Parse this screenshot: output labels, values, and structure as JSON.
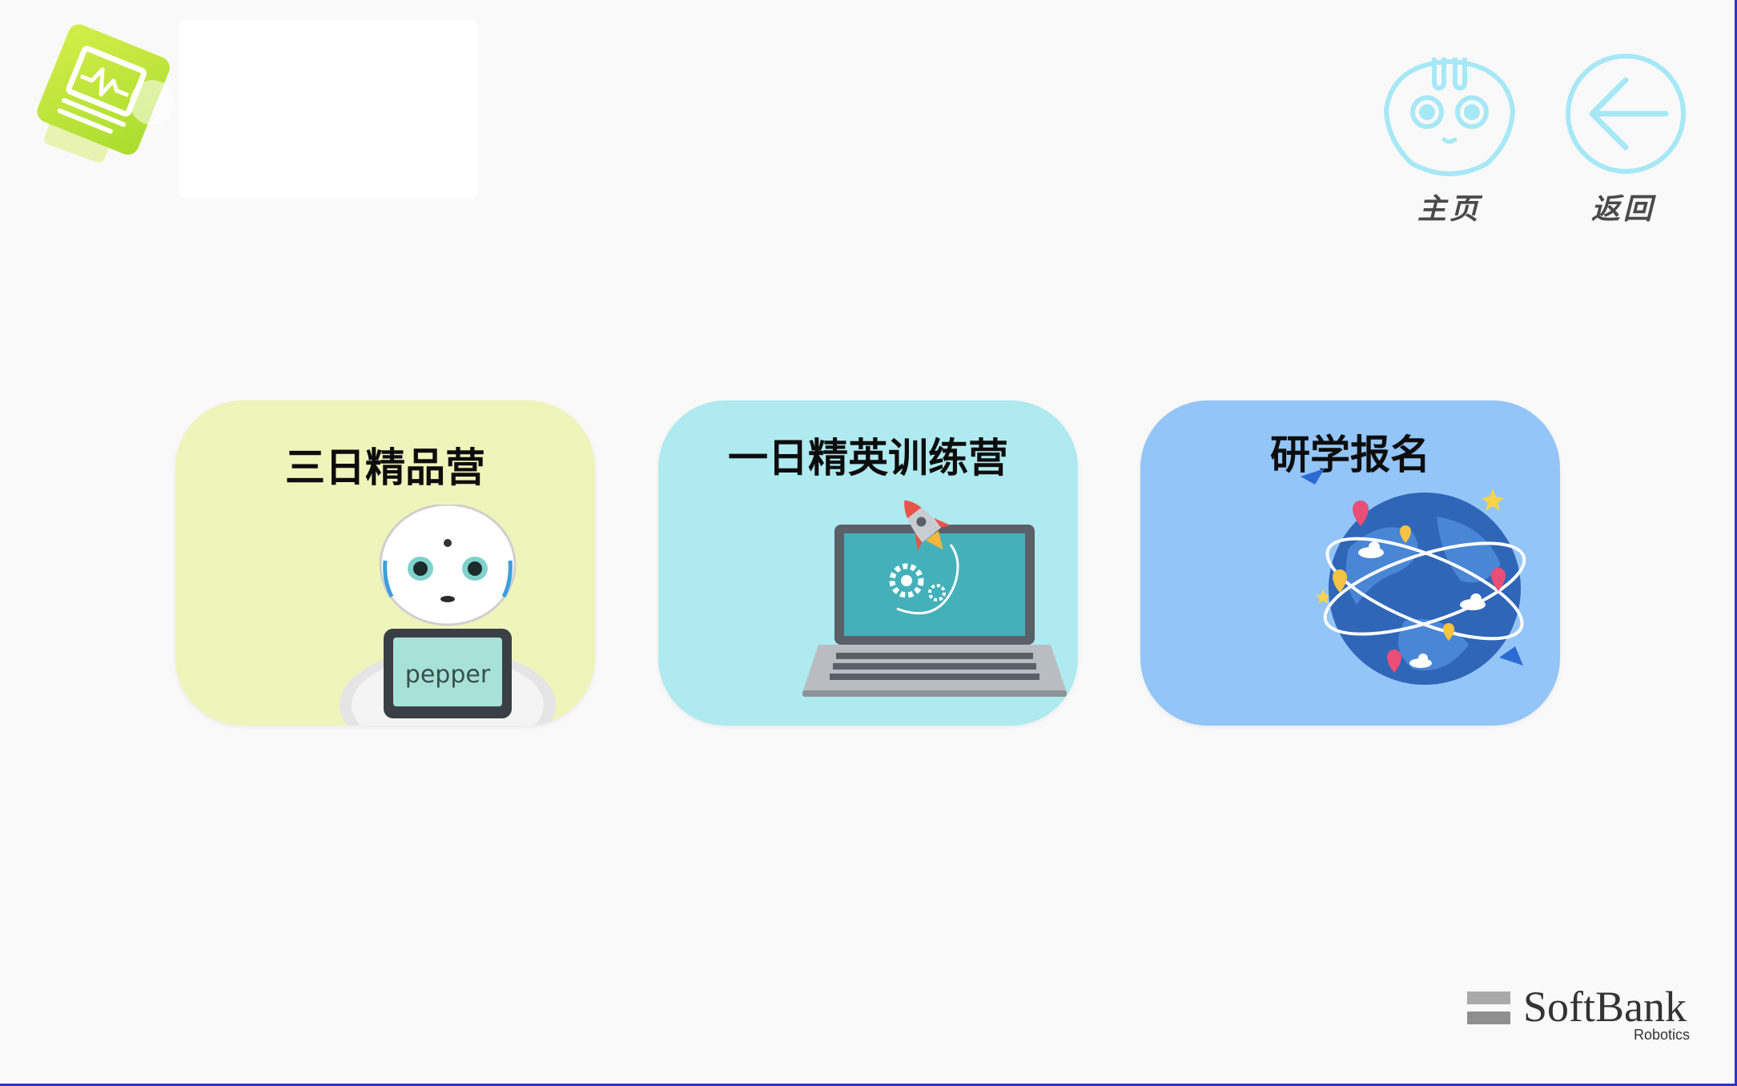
{
  "nav": {
    "home_label": "主页",
    "back_label": "返回"
  },
  "cards": [
    {
      "title": "三日精品营",
      "illustration": "pepper-robot",
      "screen_text": "pepper"
    },
    {
      "title": "一日精英训练营",
      "illustration": "laptop-rocket"
    },
    {
      "title": "研学报名",
      "illustration": "globe-map-pins"
    }
  ],
  "brand": {
    "name": "SoftBank",
    "sub": "Robotics"
  },
  "colors": {
    "background": "#f9f9f9",
    "card_1": "#eef5bb",
    "card_2": "#aeeaf0",
    "card_3": "#93c5f8",
    "nav_icon": "#a6e8f6",
    "frame": "#2b35c9",
    "logo_green": "#b8e03a"
  },
  "icons": [
    "app-logo-icon",
    "home-robot-icon",
    "back-arrow-icon"
  ]
}
